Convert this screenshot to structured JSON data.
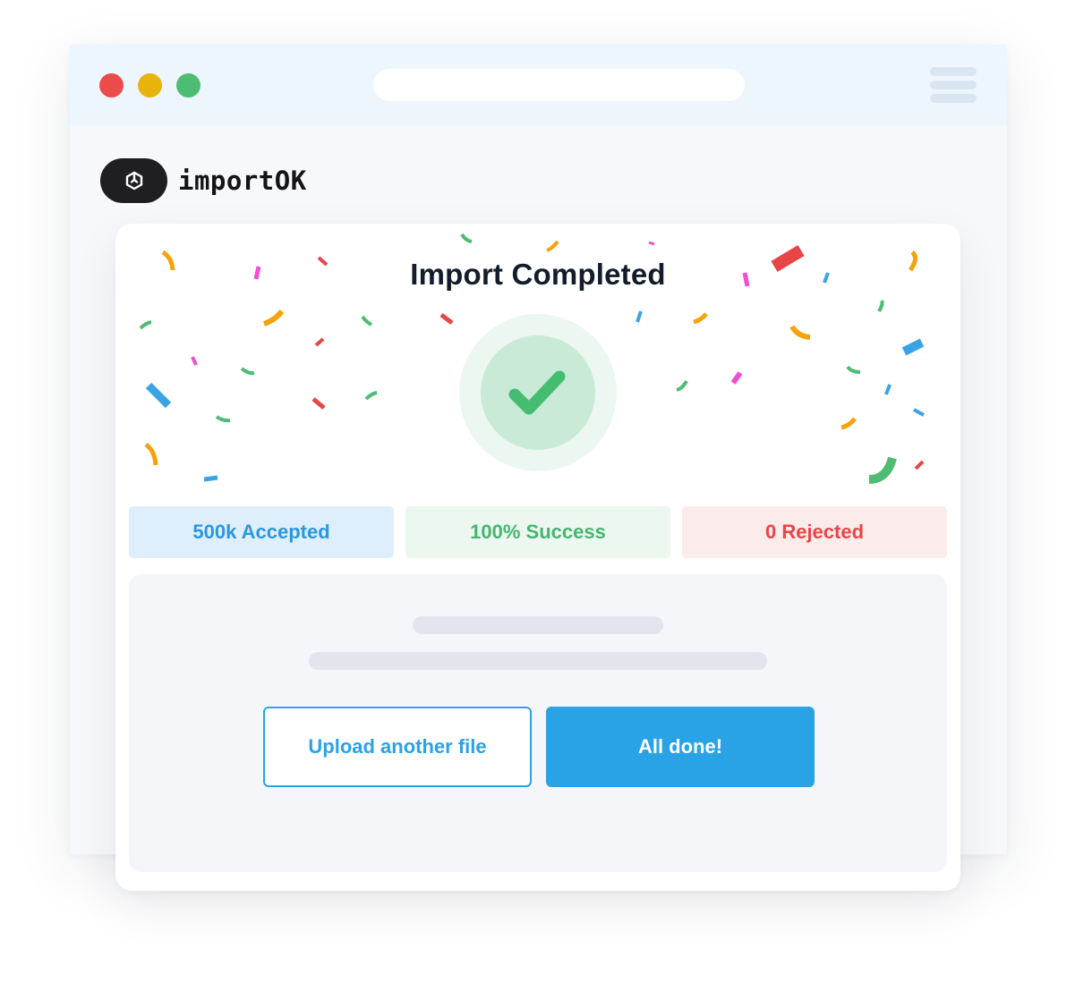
{
  "window": {
    "address_value": "",
    "controls": [
      "close",
      "minimize",
      "maximize"
    ]
  },
  "brand": {
    "name": "importOK",
    "logo_icon": "box-icon"
  },
  "card": {
    "title": "Import Completed",
    "status_icon": "checkmark-icon",
    "decoration": "confetti"
  },
  "stats": {
    "accepted": "500k Accepted",
    "success": "100% Success",
    "rejected": "0 Rejected"
  },
  "actions": {
    "upload_label": "Upload another file",
    "done_label": "All done!"
  },
  "colors": {
    "accent": "#29a3e6",
    "success": "#46b56f",
    "danger": "#e84547",
    "dark": "#1f1f21",
    "confetti": [
      "#f5a20b",
      "#3aa3e6",
      "#e84547",
      "#4cbd72",
      "#ef4fd1"
    ]
  }
}
